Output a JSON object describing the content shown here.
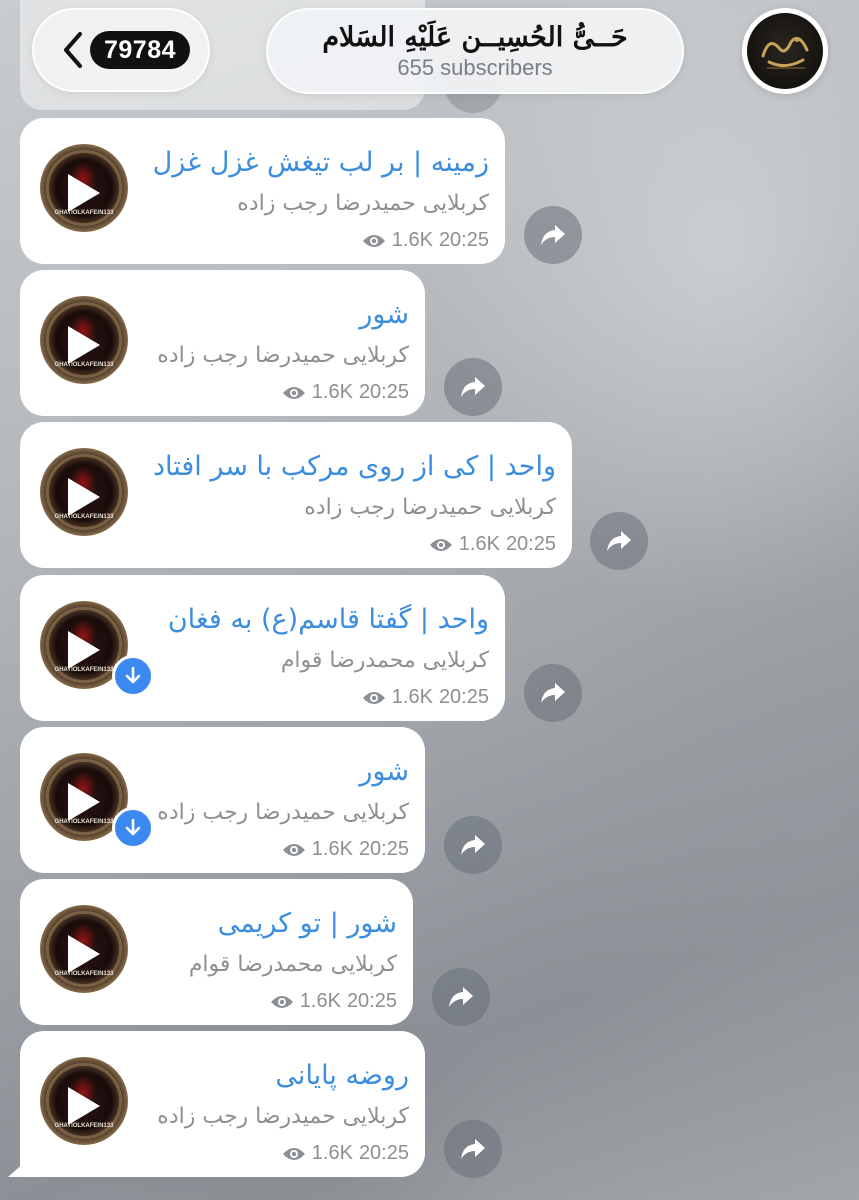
{
  "header": {
    "back_label": "back",
    "unread_count": "79784",
    "channel_title": "حَــیُّ الحُسِیــن عَلَیْهِ السَلام",
    "subscribers": "655 subscribers",
    "avatar_icon": "channel-logo-calligraphy"
  },
  "messages": [
    {
      "title": "زمینه | بر لب تیغش غزل غزل",
      "performer": "کربلایی حمیدرضا رجب زاده",
      "views": "1.6K",
      "time": "20:25",
      "downloaded": false
    },
    {
      "title": "شور",
      "performer": "کربلایی حمیدرضا رجب زاده",
      "views": "1.6K",
      "time": "20:25",
      "downloaded": false
    },
    {
      "title": "واحد | کی از روی مرکب با سر افتاد",
      "performer": "کربلایی حمیدرضا رجب زاده",
      "views": "1.6K",
      "time": "20:25",
      "downloaded": false
    },
    {
      "title": "واحد | گفتا قاسم(ع) به فغان",
      "performer": "کربلایی محمدرضا قوام",
      "views": "1.6K",
      "time": "20:25",
      "downloaded": true
    },
    {
      "title": "شور",
      "performer": "کربلایی حمیدرضا رجب زاده",
      "views": "1.6K",
      "time": "20:25",
      "downloaded": true
    },
    {
      "title": "شور | تو کریمی",
      "performer": "کربلایی محمدرضا قوام",
      "views": "1.6K",
      "time": "20:25",
      "downloaded": false
    },
    {
      "title": "روضه پایانی",
      "performer": "کربلایی حمیدرضا رجب زاده",
      "views": "1.6K",
      "time": "20:25",
      "downloaded": false
    }
  ],
  "thumb_watermark": "GHATIOLKAFEIN133",
  "colors": {
    "accent": "#3b8de0",
    "badge": "#3b88f0",
    "meta": "#8c9094"
  }
}
